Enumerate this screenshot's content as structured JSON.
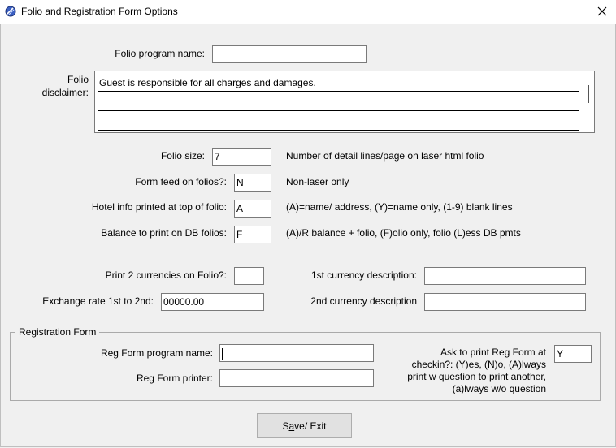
{
  "window": {
    "title": "Folio and Registration Form Options"
  },
  "folio": {
    "program_name_label": "Folio program name:",
    "program_name_value": "",
    "disclaimer_label_1": "Folio",
    "disclaimer_label_2": "disclaimer:",
    "disclaimer_lines": [
      "Guest is responsible for all charges and damages.",
      "",
      ""
    ],
    "size_label": "Folio size:",
    "size_value": "7",
    "size_hint": "Number of detail lines/page on laser html folio",
    "form_feed_label": "Form feed on folios?:",
    "form_feed_value": "N",
    "form_feed_hint": "Non-laser only",
    "hotel_info_label": "Hotel info printed at top of folio:",
    "hotel_info_value": "A",
    "hotel_info_hint": "(A)=name/ address, (Y)=name only, (1-9) blank lines",
    "balance_label": "Balance to print on DB folios:",
    "balance_value": "F",
    "balance_hint": "(A)/R balance + folio, (F)olio only, folio (L)ess DB pmts"
  },
  "currency": {
    "print2_label": "Print 2 currencies on Folio?:",
    "print2_value": "",
    "exchange_label": "Exchange rate 1st to 2nd:",
    "exchange_value": "00000.00",
    "first_desc_label": "1st currency description:",
    "first_desc_value": "",
    "second_desc_label": "2nd currency description",
    "second_desc_value": ""
  },
  "registration": {
    "group_title": "Registration Form",
    "program_name_label": "Reg Form program name:",
    "program_name_value": "",
    "printer_label": "Reg Form printer:",
    "printer_value": "",
    "ask_label_lines": [
      "Ask to print Reg Form at",
      "checkin?: (Y)es, (N)o, (A)lways",
      "print w question to print another,",
      "(a)lways w/o question"
    ],
    "ask_value": "Y"
  },
  "actions": {
    "save_exit_pre": "S",
    "save_exit_mnemonic": "a",
    "save_exit_post": "ve/ Exit"
  },
  "icons": {
    "app": "app-icon",
    "close": "close-icon"
  }
}
